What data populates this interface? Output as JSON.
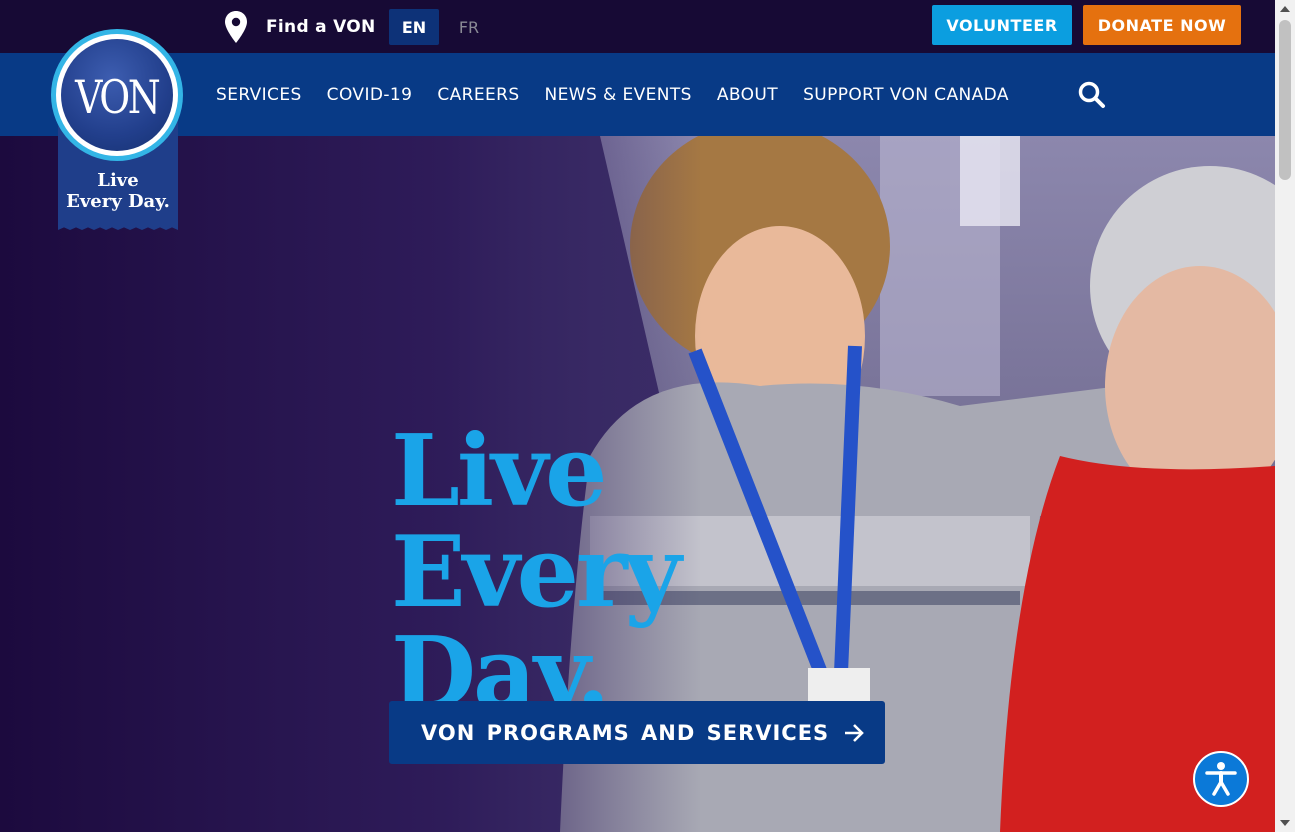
{
  "topbar": {
    "find_label": "Find a VON",
    "lang_en": "EN",
    "lang_fr": "FR",
    "volunteer_label": "VOLUNTEER",
    "donate_label": "DONATE NOW"
  },
  "logo": {
    "text": "VON",
    "tagline_line1": "Live",
    "tagline_line2": "Every Day."
  },
  "nav": {
    "items": [
      "SERVICES",
      "COVID-19",
      "CAREERS",
      "NEWS & EVENTS",
      "ABOUT",
      "SUPPORT VON CANADA"
    ],
    "search_icon": "search-icon"
  },
  "hero": {
    "title_line1": "Live",
    "title_line2": "Every",
    "title_line3": "Day.",
    "cta_label": "VON PROGRAMS AND SERVICES",
    "cta_icon": "arrow-right-icon"
  },
  "colors": {
    "topbar_bg": "#170a35",
    "nav_bg": "#083a86",
    "accent_blue": "#0b9ee0",
    "donate_orange": "#e5710f",
    "hero_title": "#1aa4e8"
  }
}
